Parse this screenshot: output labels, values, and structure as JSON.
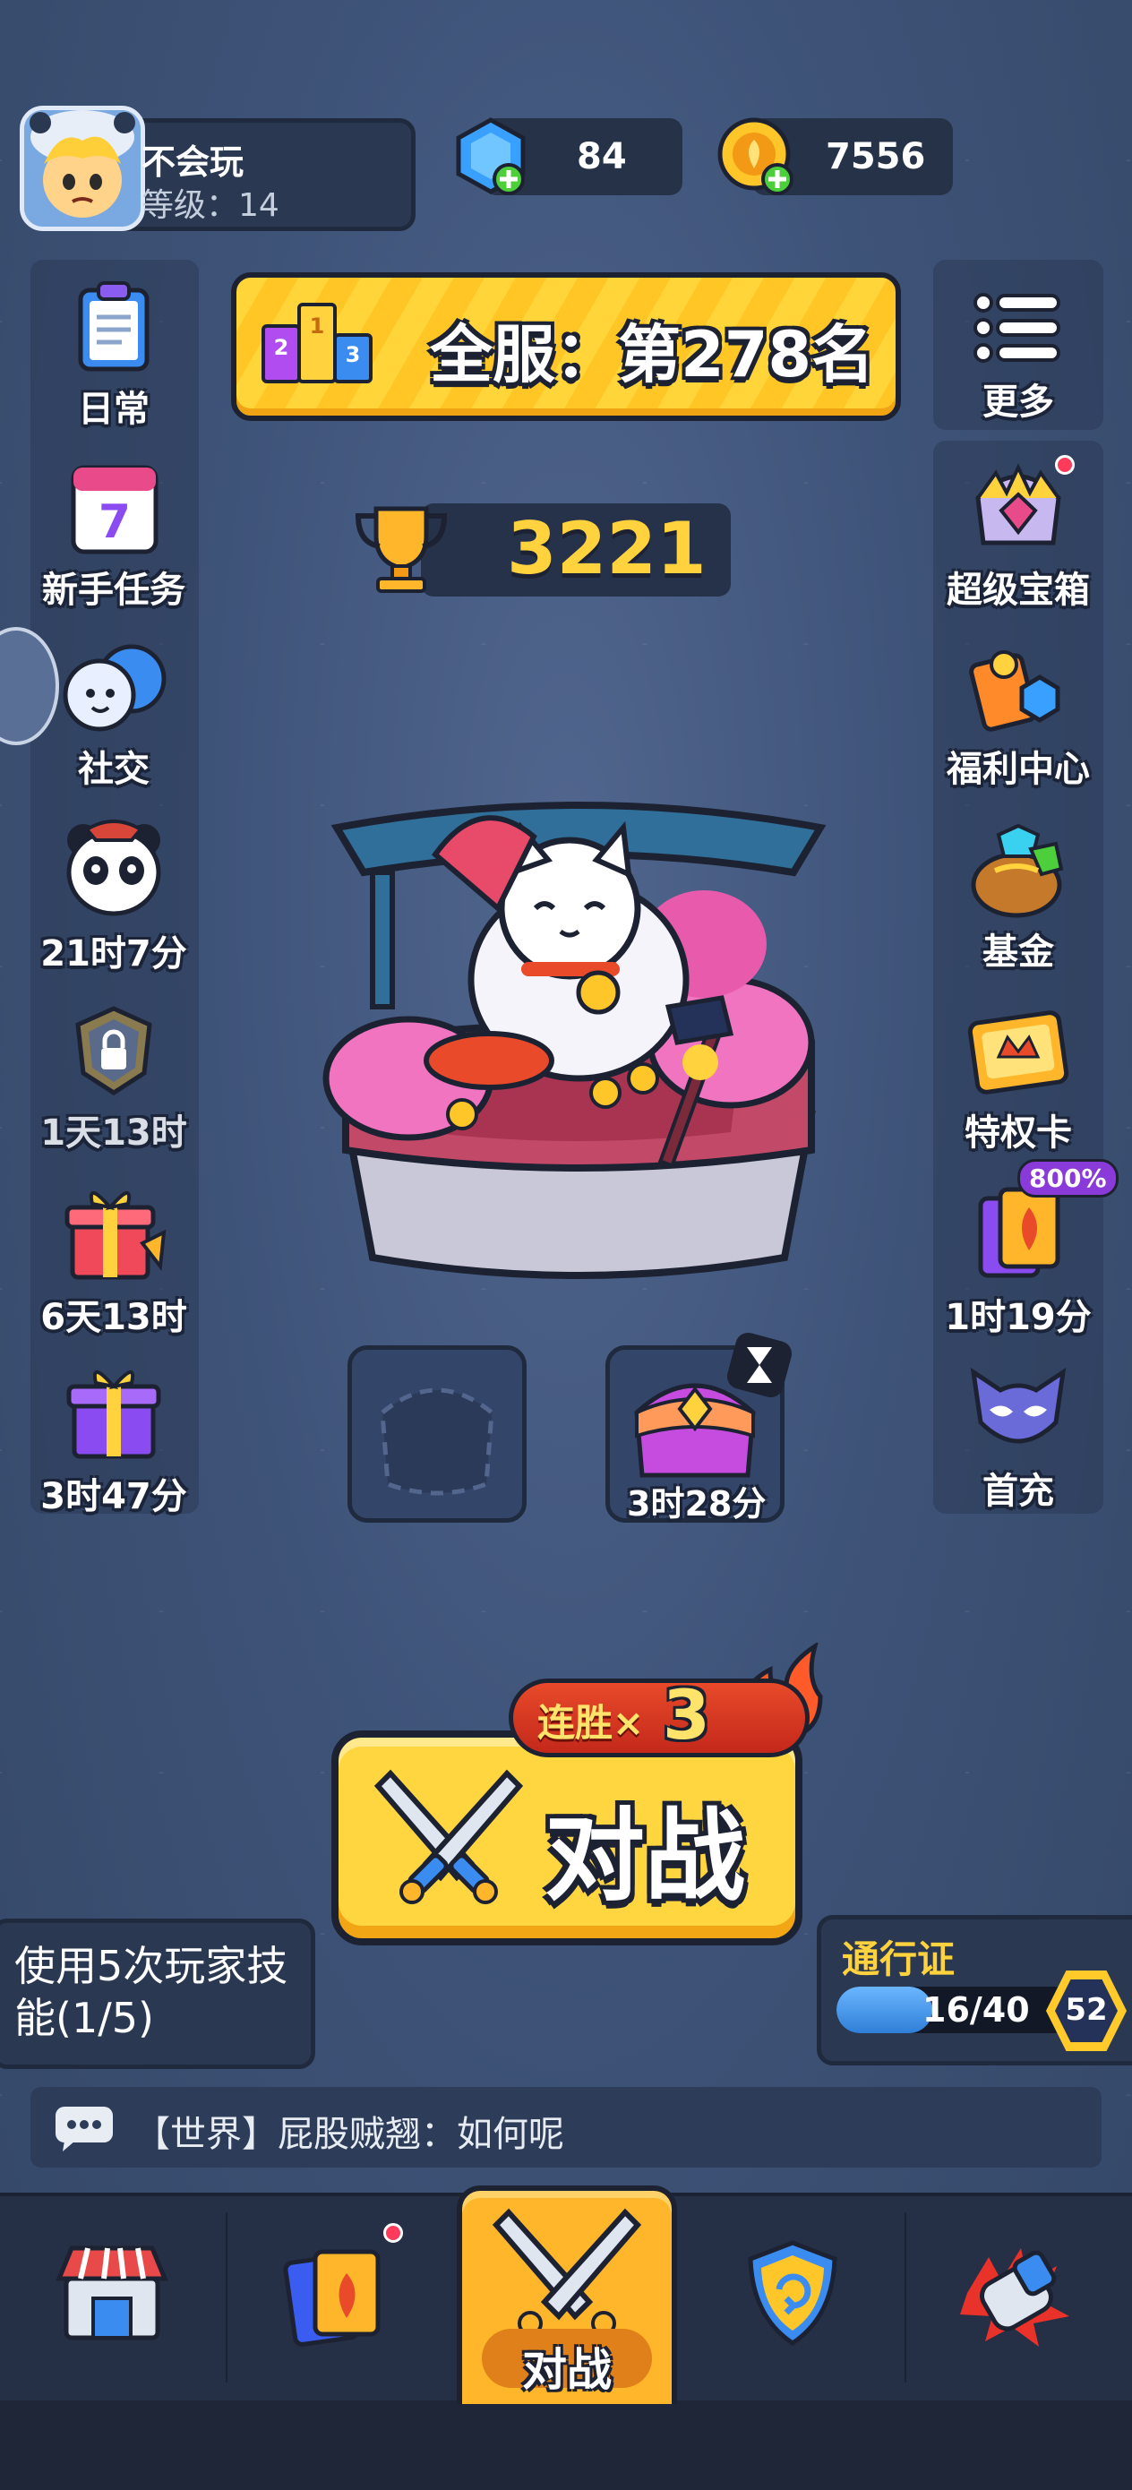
{
  "profile": {
    "name": "不会玩",
    "level": "等级：14"
  },
  "currency": {
    "gems": "84",
    "coins": "7556"
  },
  "rank": {
    "text": "全服：第278名"
  },
  "trophies": "3221",
  "left_menu": [
    {
      "label": "日常",
      "icon": "clipboard-icon"
    },
    {
      "label": "新手任务",
      "icon": "calendar-icon"
    },
    {
      "label": "社交",
      "icon": "social-icon"
    },
    {
      "label": "21时7分",
      "icon": "panda-icon"
    },
    {
      "label": "1天13时",
      "icon": "locked-badge-icon"
    },
    {
      "label": "6天13时",
      "icon": "gift-icon"
    },
    {
      "label": "3时47分",
      "icon": "gift-purple-icon"
    }
  ],
  "right_menu": [
    {
      "label": "更多",
      "icon": "list-icon"
    },
    {
      "label": "超级宝箱",
      "icon": "super-chest-icon"
    },
    {
      "label": "福利中心",
      "icon": "welfare-icon"
    },
    {
      "label": "基金",
      "icon": "fund-icon"
    },
    {
      "label": "特权卡",
      "icon": "privilege-card-icon"
    },
    {
      "label": "1时19分",
      "icon": "card-pack-icon",
      "badge": "800%"
    },
    {
      "label": "首充",
      "icon": "mask-icon"
    }
  ],
  "slots": [
    {
      "label": ""
    },
    {
      "label": "3时28分"
    }
  ],
  "battle": {
    "label": "对战",
    "streak_label": "连胜×",
    "streak_count": "3"
  },
  "task": {
    "text": "使用5次玩家技能(1/5)"
  },
  "pass": {
    "title": "通行证",
    "progress": "16/40",
    "progress_fraction": 0.4,
    "level": "52"
  },
  "chat": {
    "text": "【世界】屁股贼翘：如何呢"
  },
  "nav": {
    "active_label": "对战"
  },
  "colors": {
    "accent_yellow": "#ffd640",
    "background": "#3b4f73",
    "badge_red": "#ff3b5c"
  }
}
